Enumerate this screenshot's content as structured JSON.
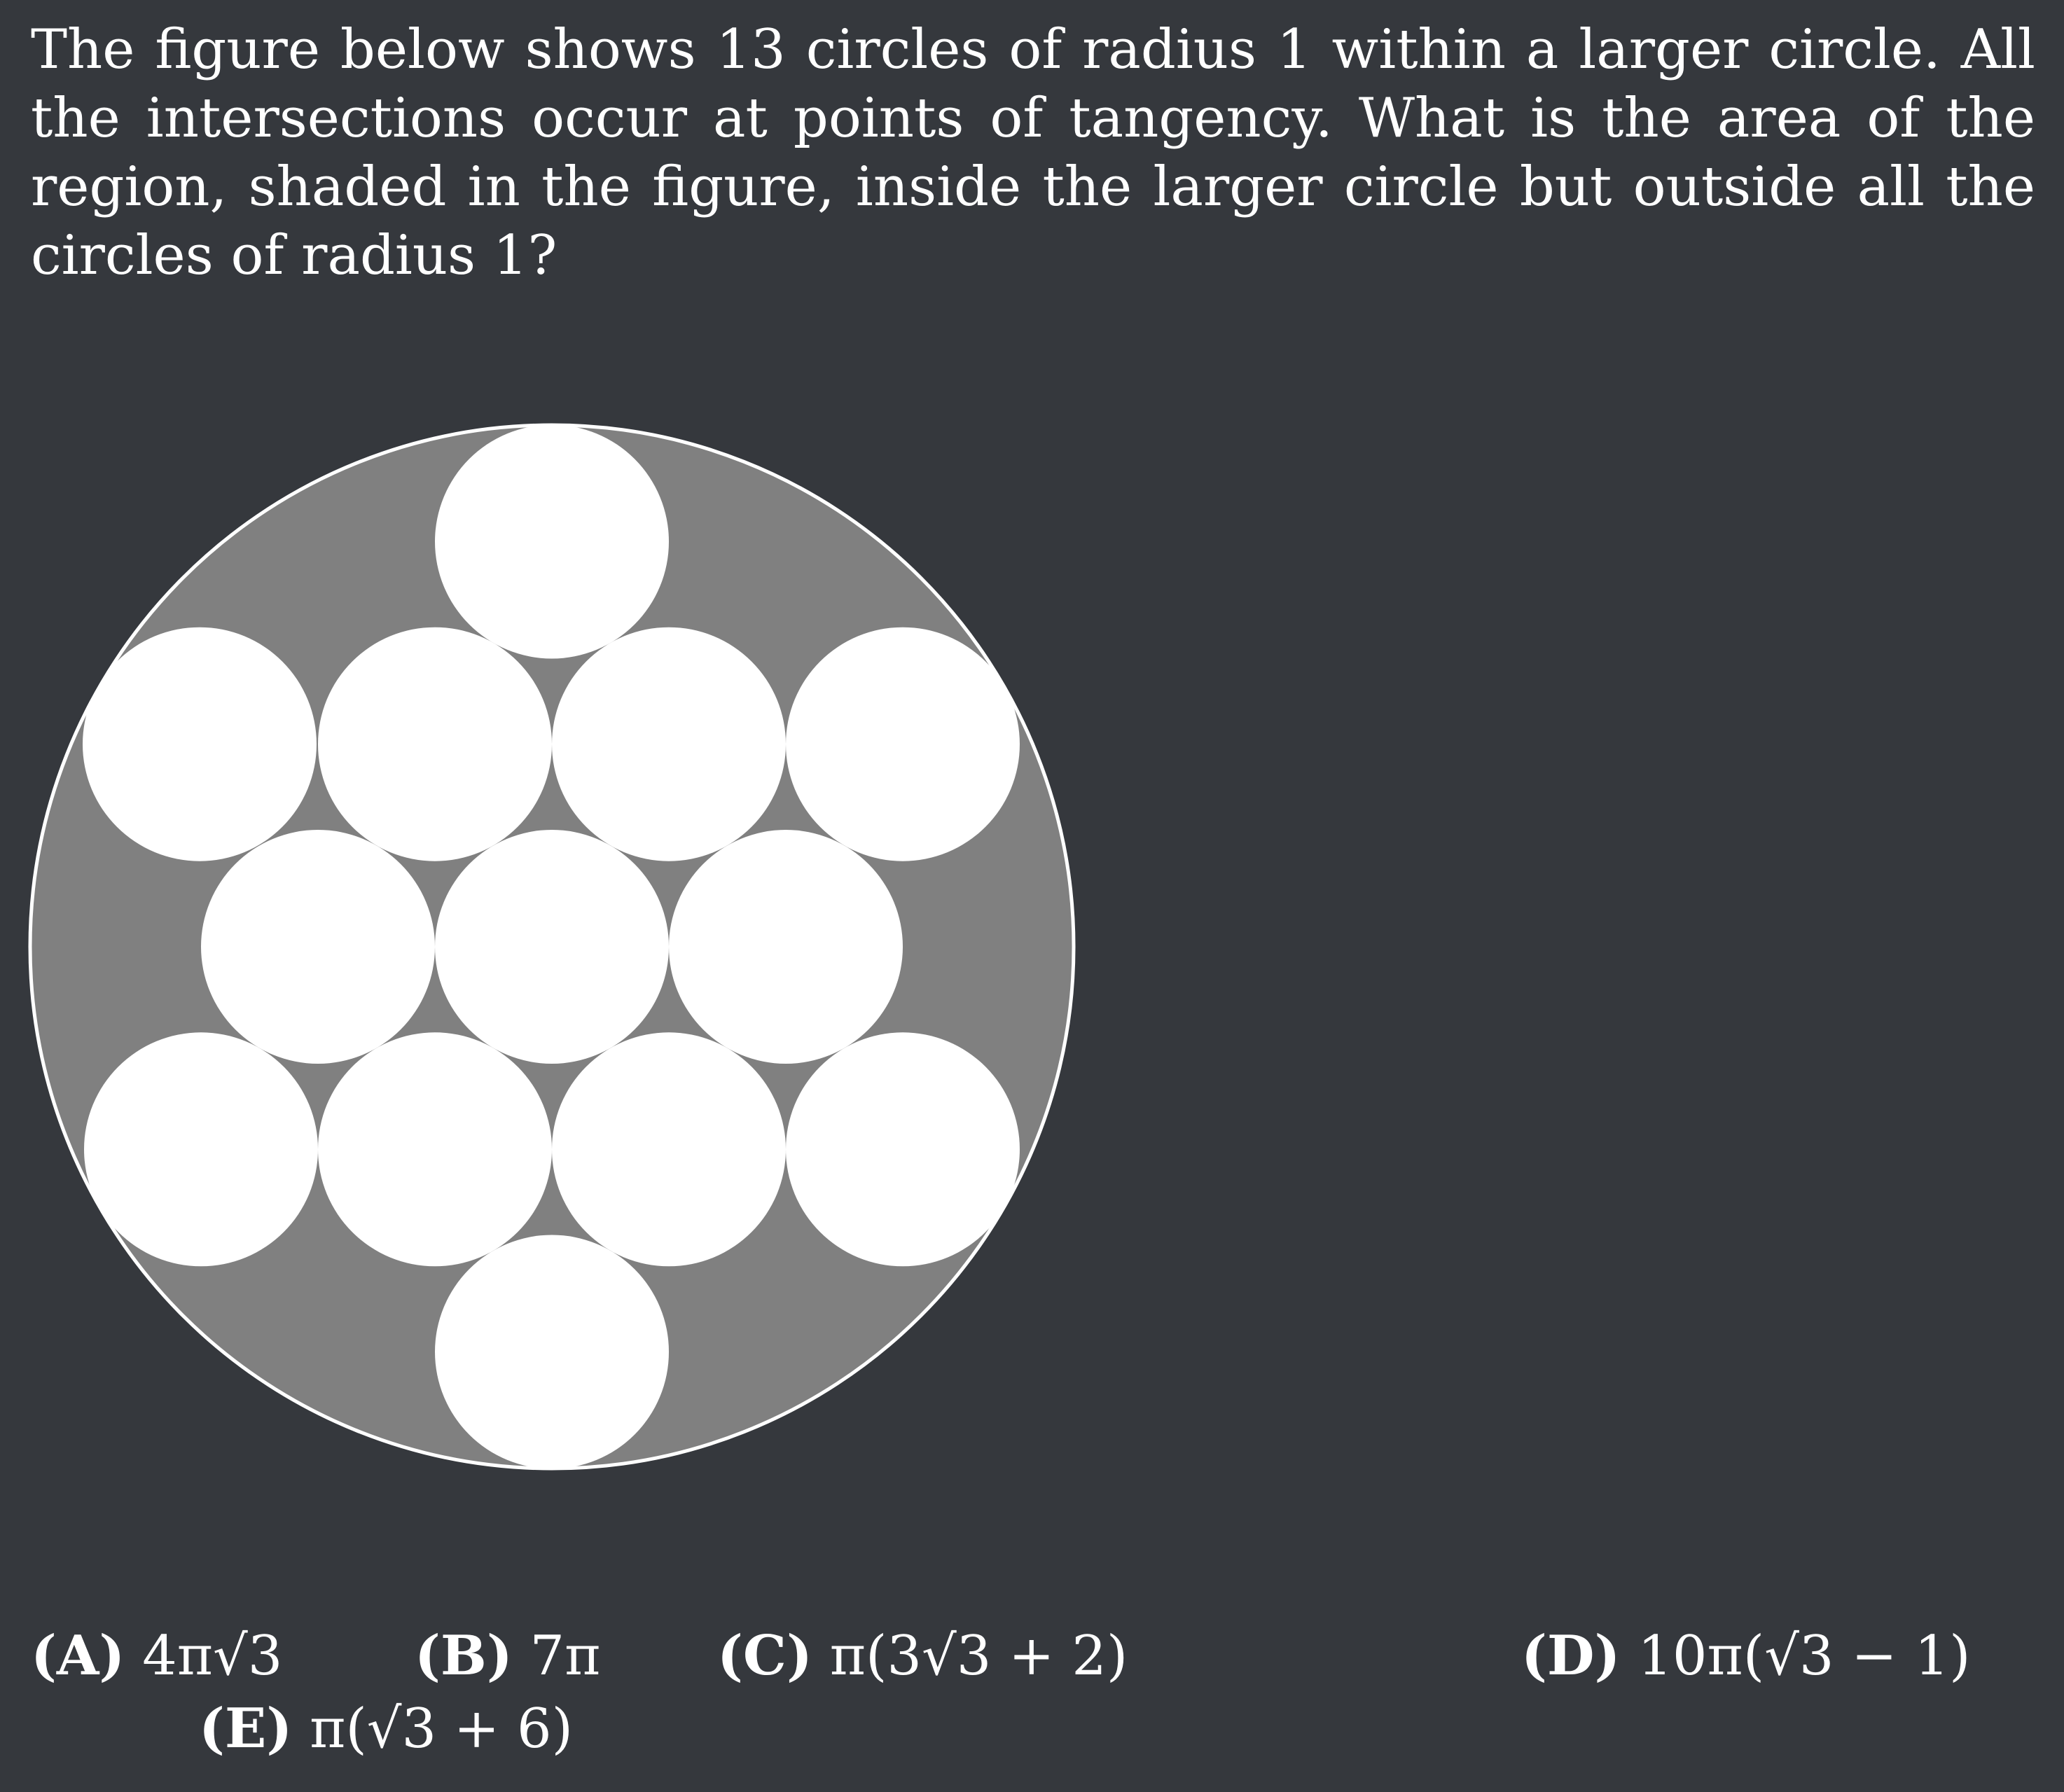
{
  "problem": {
    "text": "The figure below shows 13 circles of radius 1 within a larger circle. All the intersections occur at points of tangency. What is the area of the region, shaded in the figure, inside the larger circle but outside all the circles of radius 1?"
  },
  "figure": {
    "small_circle_count": 13,
    "small_circle_radius": 1,
    "colors": {
      "background": "#35383d",
      "shaded_region": "#808080",
      "small_circles": "#ffffff",
      "outline": "#ffffff"
    }
  },
  "choices": [
    {
      "letter": "(A)",
      "value": "4π√3"
    },
    {
      "letter": "(B)",
      "value": "7π"
    },
    {
      "letter": "(C)",
      "value": "π(3√3 + 2)"
    },
    {
      "letter": "(D)",
      "value": "10π(√3 − 1)"
    },
    {
      "letter": "(E)",
      "value": "π(√3 + 6)"
    }
  ]
}
